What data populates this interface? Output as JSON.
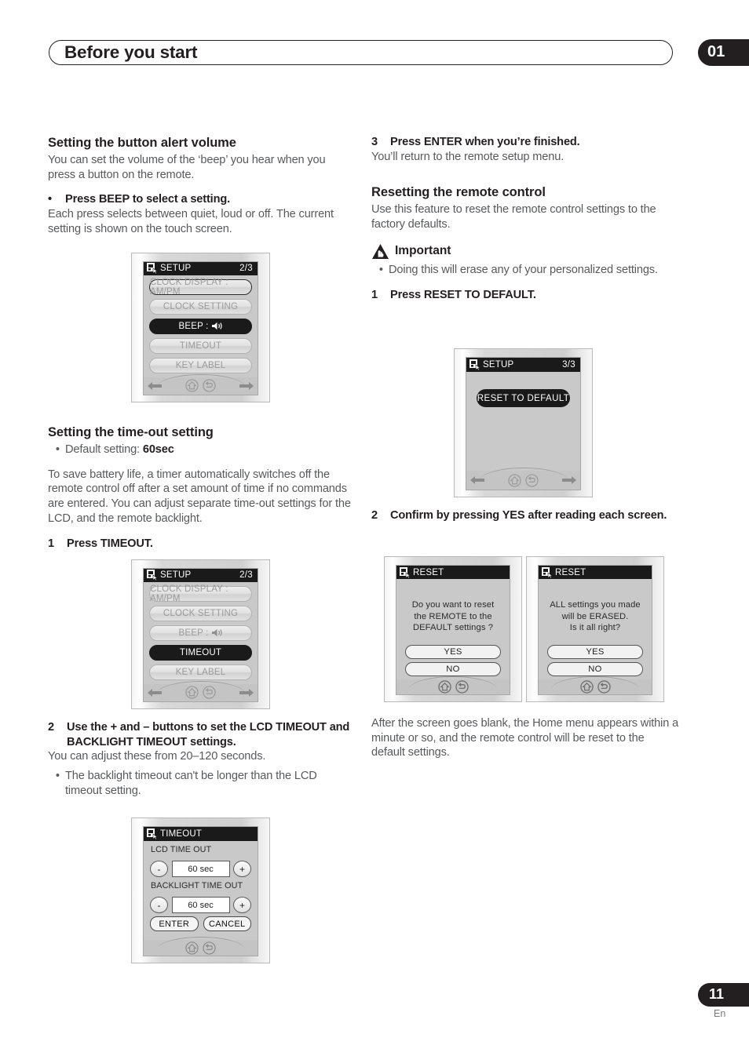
{
  "header": {
    "title": "Before you start",
    "chapter": "01"
  },
  "footer": {
    "page": "11",
    "lang": "En"
  },
  "left": {
    "section1": {
      "heading": "Setting the button alert volume",
      "intro": "You can set the volume of the ‘beep’ you hear when you press a button on the remote.",
      "bullet_bold": "Press BEEP to select a setting.",
      "bullet_body": "Each press selects between quiet, loud or off. The current setting is shown on the touch screen."
    },
    "screen_beep": {
      "title": "SETUP",
      "page": "2/3",
      "items": [
        {
          "label": "CLOCK DISPLAY : AM/PM",
          "state": "outlined"
        },
        {
          "label": "CLOCK SETTING",
          "state": "normal"
        },
        {
          "label": "BEEP :",
          "state": "selected",
          "icon": "speaker-icon"
        },
        {
          "label": "TIMEOUT",
          "state": "normal"
        },
        {
          "label": "KEY LABEL",
          "state": "normal"
        }
      ]
    },
    "section2": {
      "heading": "Setting the time-out setting",
      "default_bullet_prefix": "Default setting: ",
      "default_bullet_value": "60sec",
      "body": "To save battery life, a timer automatically switches off the remote control off after a set amount of time if no commands are entered. You can adjust separate time-out settings for the LCD, and the remote backlight.",
      "step1_num": "1",
      "step1_text": "Press TIMEOUT."
    },
    "screen_timeout_menu": {
      "title": "SETUP",
      "page": "2/3",
      "items": [
        {
          "label": "CLOCK DISPLAY : AM/PM",
          "state": "normal"
        },
        {
          "label": "CLOCK SETTING",
          "state": "normal"
        },
        {
          "label": "BEEP :",
          "state": "normal",
          "icon": "speaker-icon"
        },
        {
          "label": "TIMEOUT",
          "state": "selected"
        },
        {
          "label": "KEY LABEL",
          "state": "normal"
        }
      ]
    },
    "section3": {
      "step2_num": "2",
      "step2_text": "Use the + and – buttons to set the LCD TIMEOUT and BACKLIGHT TIMEOUT settings.",
      "body": "You can adjust these from 20–120 seconds.",
      "bullet": "The backlight timeout can't be longer than the LCD timeout setting."
    },
    "screen_timeout": {
      "title": "TIMEOUT",
      "lcd_label": "LCD  TIME OUT",
      "lcd_value": "60 sec",
      "backlight_label": "BACKLIGHT  TIME OUT",
      "backlight_value": "60 sec",
      "minus": "-",
      "plus": "+",
      "enter": "ENTER",
      "cancel": "CANCEL"
    }
  },
  "right": {
    "step3_num": "3",
    "step3_text": "Press ENTER when you’re finished.",
    "step3_body": "You’ll return to the remote setup menu.",
    "section1": {
      "heading": "Resetting the remote control",
      "body": "Use this feature to reset the remote control settings to the factory defaults."
    },
    "important": {
      "label": "Important",
      "bullet": "Doing this will erase any of your personalized settings."
    },
    "step1_num": "1",
    "step1_text": "Press RESET TO DEFAULT.",
    "screen_reset_default": {
      "title": "SETUP",
      "page": "3/3",
      "button": "RESET TO DEFAULT"
    },
    "step2_num": "2",
    "step2_text": "Confirm by pressing YES after reading each screen.",
    "screen_confirm1": {
      "title": "RESET",
      "lines": [
        "Do  you  want  to  reset",
        "the  REMOTE  to  the",
        "DEFAULT  settings ?"
      ],
      "yes": "YES",
      "no": "NO"
    },
    "screen_confirm2": {
      "title": "RESET",
      "lines": [
        "ALL settings you made",
        "will be ERASED.",
        "Is it all right?"
      ],
      "yes": "YES",
      "no": "NO"
    },
    "closing": "After the screen goes blank, the Home menu appears within a minute or so, and the remote control will be reset to the default settings."
  }
}
